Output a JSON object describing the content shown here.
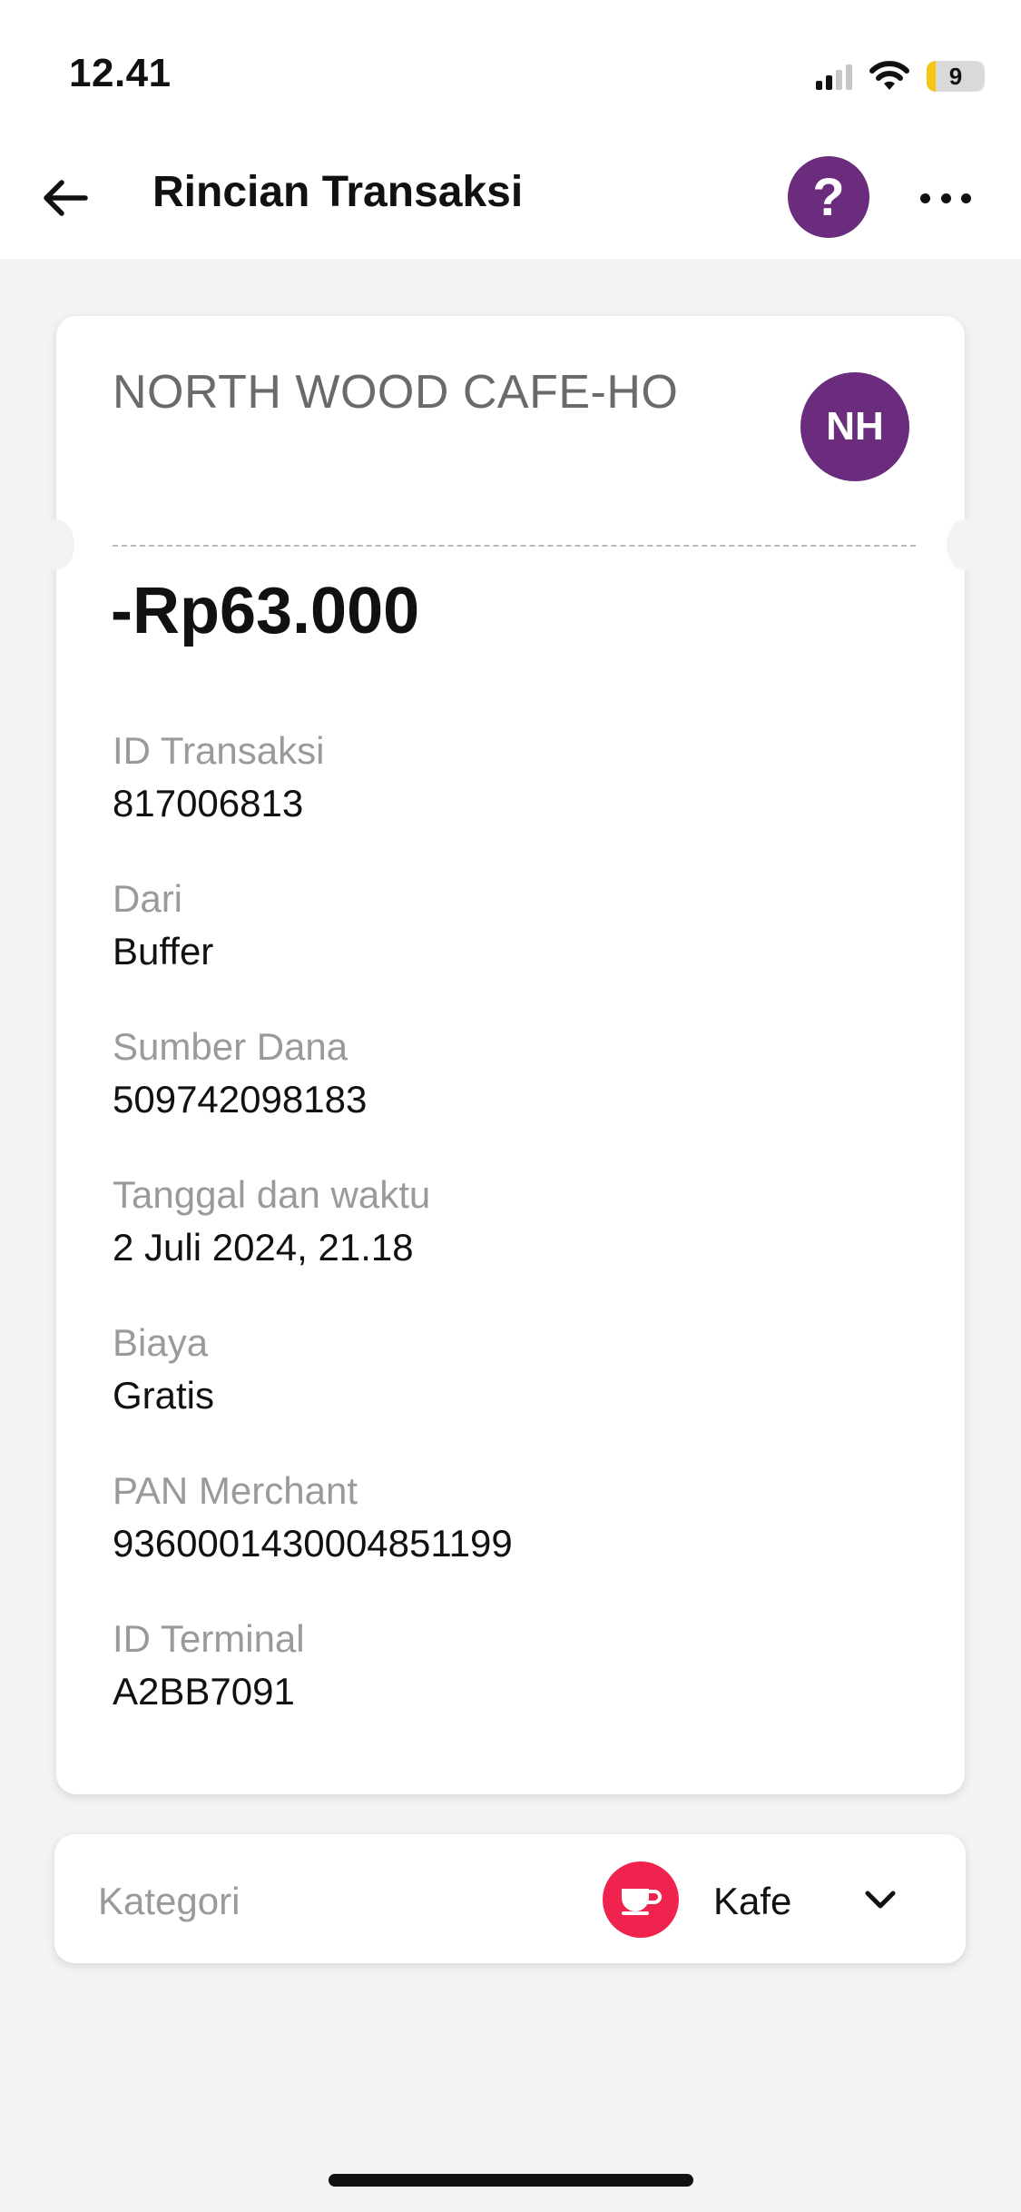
{
  "status_bar": {
    "time": "12.41",
    "battery_level": "9"
  },
  "header": {
    "title": "Rincian Transaksi",
    "help_label": "?"
  },
  "merchant": {
    "name": "NORTH WOOD CAFE-HO",
    "initials": "NH",
    "avatar_color": "#6b2c7e"
  },
  "transaction": {
    "amount": "-Rp63.000",
    "details": [
      {
        "label": "ID Transaksi",
        "value": "817006813"
      },
      {
        "label": "Dari",
        "value": "Buffer"
      },
      {
        "label": "Sumber Dana",
        "value": "509742098183"
      },
      {
        "label": "Tanggal dan waktu",
        "value": "2 Juli 2024, 21.18"
      },
      {
        "label": "Biaya",
        "value": "Gratis"
      },
      {
        "label": "PAN Merchant",
        "value": "9360001430004851199"
      },
      {
        "label": "ID Terminal",
        "value": "A2BB7091"
      }
    ]
  },
  "category": {
    "label": "Kategori",
    "value": "Kafe",
    "icon": "coffee-cup-icon",
    "icon_color": "#f0224e"
  },
  "icons": [
    "back-arrow-icon",
    "help-icon",
    "more-icon",
    "signal-icon",
    "wifi-icon",
    "battery-icon",
    "coffee-cup-icon",
    "chevron-down-icon"
  ]
}
